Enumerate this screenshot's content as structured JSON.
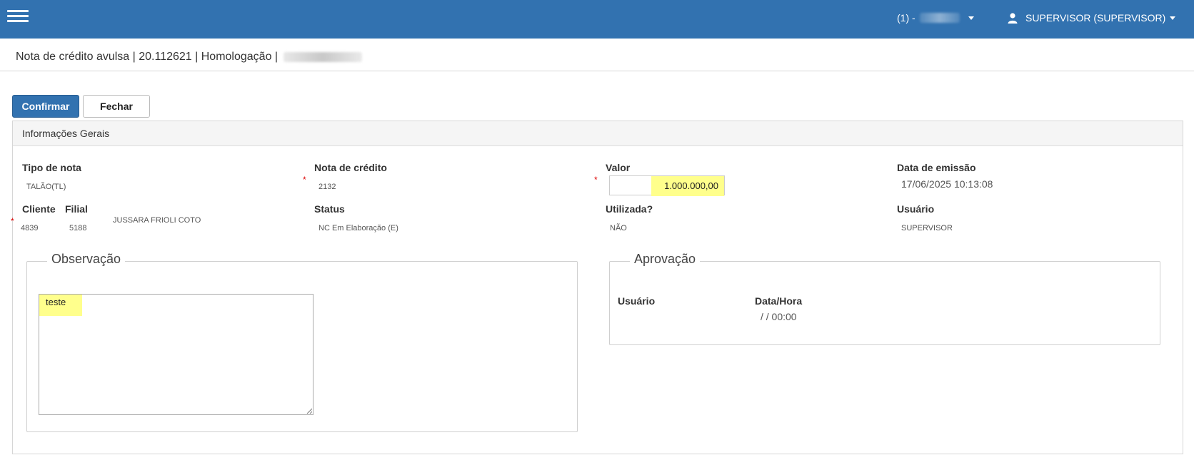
{
  "header": {
    "company_label": "(1) -",
    "user_label": "SUPERVISOR (SUPERVISOR)"
  },
  "page": {
    "title": "Nota de crédito avulsa | 20.112621 | Homologação |"
  },
  "toolbar": {
    "confirm_label": "Confirmar",
    "close_label": "Fechar"
  },
  "panel": {
    "heading": "Informações Gerais",
    "fields": {
      "tipo_nota": {
        "label": "Tipo de nota",
        "value": "TALÃO(TL)"
      },
      "nota_credito": {
        "label": "Nota de crédito",
        "value": "2132"
      },
      "valor": {
        "label": "Valor",
        "value": "1.000.000,00"
      },
      "data_emissao": {
        "label": "Data de emissão",
        "value": "17/06/2025 10:13:08"
      },
      "cliente": {
        "label": "Cliente",
        "value": "4839"
      },
      "filial": {
        "label": "Filial",
        "value": "5188"
      },
      "cliente_nome": "JUSSARA FRIOLI COTO",
      "status": {
        "label": "Status",
        "value": "NC Em Elaboração (E)"
      },
      "utilizada": {
        "label": "Utilizada?",
        "value": "NÃO"
      },
      "usuario": {
        "label": "Usuário",
        "value": "SUPERVISOR"
      }
    },
    "required_marker": "*"
  },
  "observacao": {
    "legend": "Observação",
    "text": "teste"
  },
  "aprovacao": {
    "legend": "Aprovação",
    "usuario_label": "Usuário",
    "datahora_label": "Data/Hora",
    "datahora_value": "/ / 00:00"
  },
  "colors": {
    "header_bg": "#3272b0",
    "highlight": "#ffff8c",
    "required": "#dd0000"
  }
}
